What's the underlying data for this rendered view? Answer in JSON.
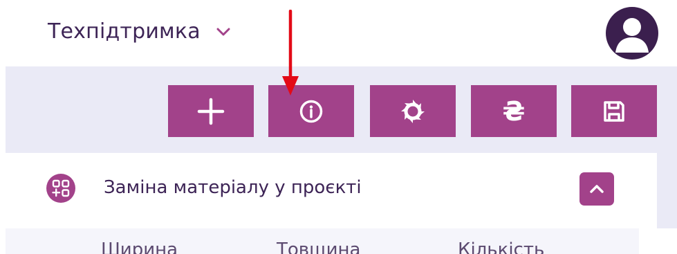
{
  "header": {
    "title": "Техпідтримка",
    "dropdown_icon": "chevron-down-icon",
    "avatar_icon": "user-icon"
  },
  "toolbar": {
    "buttons": [
      {
        "name": "add-button",
        "icon": "plus-icon"
      },
      {
        "name": "info-button",
        "icon": "info-icon"
      },
      {
        "name": "saw-button",
        "icon": "saw-blade-icon"
      },
      {
        "name": "price-button",
        "icon": "hryvnia-icon",
        "glyph": "₴"
      },
      {
        "name": "save-button",
        "icon": "floppy-disk-icon"
      }
    ]
  },
  "annotation": {
    "type": "arrow",
    "color": "#e30a17",
    "points_to": "info-button"
  },
  "section": {
    "title": "Заміна матеріалу у проєкті",
    "icon": "grid-add-icon",
    "collapse_icon": "chevron-up-icon"
  },
  "table": {
    "columns": [
      "Ширина",
      "Товщина",
      "Кількість"
    ]
  },
  "colors": {
    "accent": "#a2428a",
    "text": "#3d2456",
    "toolbar_bg": "#eaeaf6",
    "avatar": "#3b1f4e"
  }
}
